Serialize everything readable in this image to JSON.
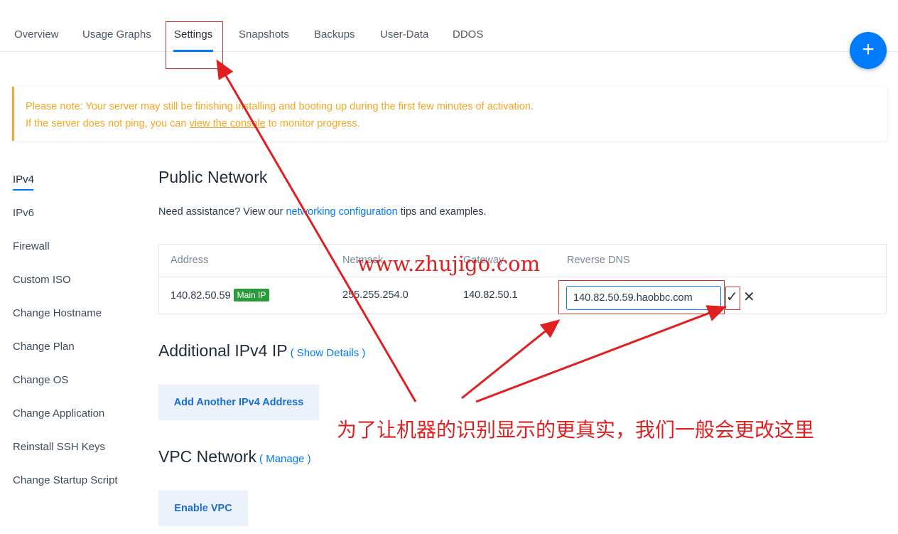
{
  "tabs": [
    "Overview",
    "Usage Graphs",
    "Settings",
    "Snapshots",
    "Backups",
    "User-Data",
    "DDOS"
  ],
  "fab": {
    "icon": "plus-icon",
    "label": "+"
  },
  "notice": {
    "line1": "Please note: Your server may still be finishing installing and booting up during the first few minutes of activation.",
    "line2_prefix": "If the server does not ping, you can ",
    "line2_link": "view the console",
    "line2_suffix": " to monitor progress."
  },
  "sidebar": {
    "items": [
      "IPv4",
      "IPv6",
      "Firewall",
      "Custom ISO",
      "Change Hostname",
      "Change Plan",
      "Change OS",
      "Change Application",
      "Reinstall SSH Keys",
      "Change Startup Script"
    ]
  },
  "public_network": {
    "title": "Public Network",
    "assist_prefix": "Need assistance? View our ",
    "assist_link": "networking configuration",
    "assist_suffix": " tips and examples.",
    "columns": [
      "Address",
      "Netmask",
      "Gateway",
      "Reverse DNS"
    ],
    "row": {
      "address": "140.82.50.59",
      "badge": "Main IP",
      "netmask": "255.255.254.0",
      "gateway": "140.82.50.1",
      "reverse_dns": "140.82.50.59.haobbc.com"
    },
    "confirm_icon": "check-icon",
    "cancel_icon": "close-icon"
  },
  "additional_ipv4": {
    "title": "Additional IPv4 IP",
    "link": "( Show Details )",
    "button": "Add Another IPv4 Address"
  },
  "vpc": {
    "title": "VPC Network",
    "link": "( Manage )",
    "button": "Enable VPC"
  },
  "annotations": {
    "watermark": "www.zhujigo.com",
    "caption": "为了让机器的识别显示的更真实，我们一般会更改这里",
    "color": "#e02020"
  },
  "colors": {
    "accent": "#007bfc",
    "warning": "#f5a623",
    "badge": "#2b9a3a"
  }
}
